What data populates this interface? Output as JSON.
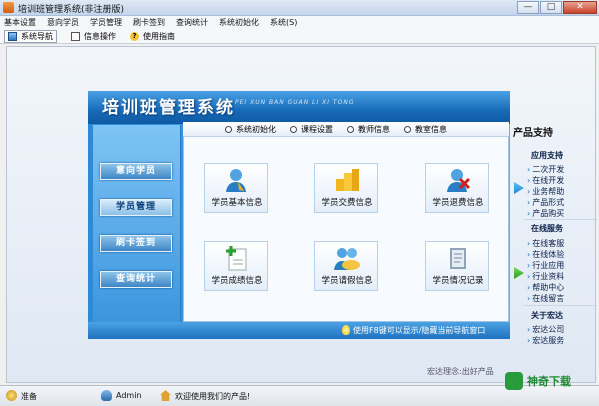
{
  "window": {
    "title": "培训班管理系统(非注册版)",
    "controls": [
      "—",
      "□",
      "✕"
    ]
  },
  "menu": [
    "基本设置",
    "意向学员",
    "学员管理",
    "刷卡签到",
    "查询统计",
    "系统初始化",
    "系统(S)"
  ],
  "toolbar": {
    "nav_label": "系统导航",
    "info_label": "信息操作",
    "help_label": "使用指南",
    "help_glyph": "?"
  },
  "panel": {
    "title": "培训班管理系统",
    "pinyin": "PEI XUN BAN GUAN LI XI TONG",
    "sidebar": [
      "意向学员",
      "学员管理",
      "刷卡签到",
      "查询统计"
    ],
    "sidebar_active_index": 1,
    "radios": [
      "系统初始化",
      "课程设置",
      "教师信息",
      "教室信息"
    ],
    "cards": [
      {
        "label": "学员基本信息",
        "icon": "student-user-icon"
      },
      {
        "label": "学员交费信息",
        "icon": "coins-icon"
      },
      {
        "label": "学员退费信息",
        "icon": "refund-icon"
      },
      {
        "label": "学员成绩信息",
        "icon": "grade-add-icon"
      },
      {
        "label": "学员请假信息",
        "icon": "leave-chat-icon"
      },
      {
        "label": "学员情况记录",
        "icon": "record-book-icon"
      }
    ],
    "hint": "使用F8键可以显示/隐藏当前导航窗口"
  },
  "product_panel": {
    "heading": "产品支持",
    "sections": [
      {
        "title": "应用支持",
        "links": [
          "二次开发",
          "在线开发",
          "业务帮助",
          "产品形式",
          "产品购买"
        ]
      },
      {
        "title": "在线服务",
        "links": [
          "在线客服",
          "在线体验",
          "行业应用",
          "行业资料",
          "帮助中心",
          "在线留言"
        ]
      },
      {
        "title": "关于宏达",
        "links": [
          "宏达公司",
          "宏达服务"
        ]
      }
    ]
  },
  "footer_text": "宏达理念:出好产品",
  "statusbar": {
    "ready": "准备",
    "user": "Admin",
    "welcome": "欢迎使用我们的产品!"
  },
  "watermark": {
    "text": "神奇下载"
  },
  "colors": {
    "panel_blue": "#176ab8",
    "accent_green": "#2a9b3c"
  }
}
